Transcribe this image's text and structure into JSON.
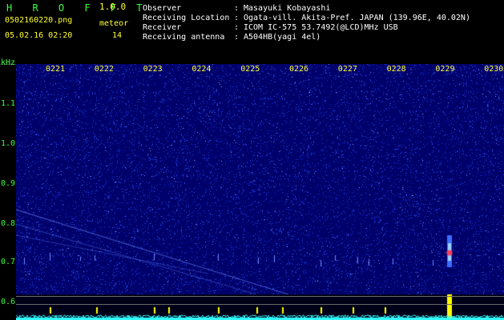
{
  "app": {
    "title": "H R O F F T",
    "version": "1.0.0",
    "filename": "0502160220.png",
    "timestamp": "05.02.16 02:20",
    "meteor_label": "meteor",
    "meteor_count": "14"
  },
  "info": {
    "rows": [
      {
        "label": "Observer",
        "value": "Masayuki Kobayashi"
      },
      {
        "label": "Receiving Location",
        "value": "Ogata-vill. Akita-Pref. JAPAN (139.96E, 40.02N)"
      },
      {
        "label": "Receiver",
        "value": "ICOM IC-575 53.7492(@LCD)MHz USB"
      },
      {
        "label": "Receiving antenna",
        "value": "A504HB(yagi 4el)"
      }
    ]
  },
  "spectrogram": {
    "y_unit": "kHz",
    "y_ticks": [
      "1.1",
      "1.0",
      "0.9",
      "0.8",
      "0.7",
      "0.6"
    ],
    "y_range": [
      0.6,
      1.16
    ],
    "x_ticks": [
      "0221",
      "0222",
      "0223",
      "0224",
      "0225",
      "0226",
      "0227",
      "0228",
      "0229",
      "0230"
    ],
    "colors": {
      "background": "#00006a",
      "noise": "#2850ff",
      "text_green": "#3cff3c",
      "text_yellow": "#ffff33",
      "spectrum": "#33ffff",
      "meteor_marker": "#ffff00"
    }
  }
}
